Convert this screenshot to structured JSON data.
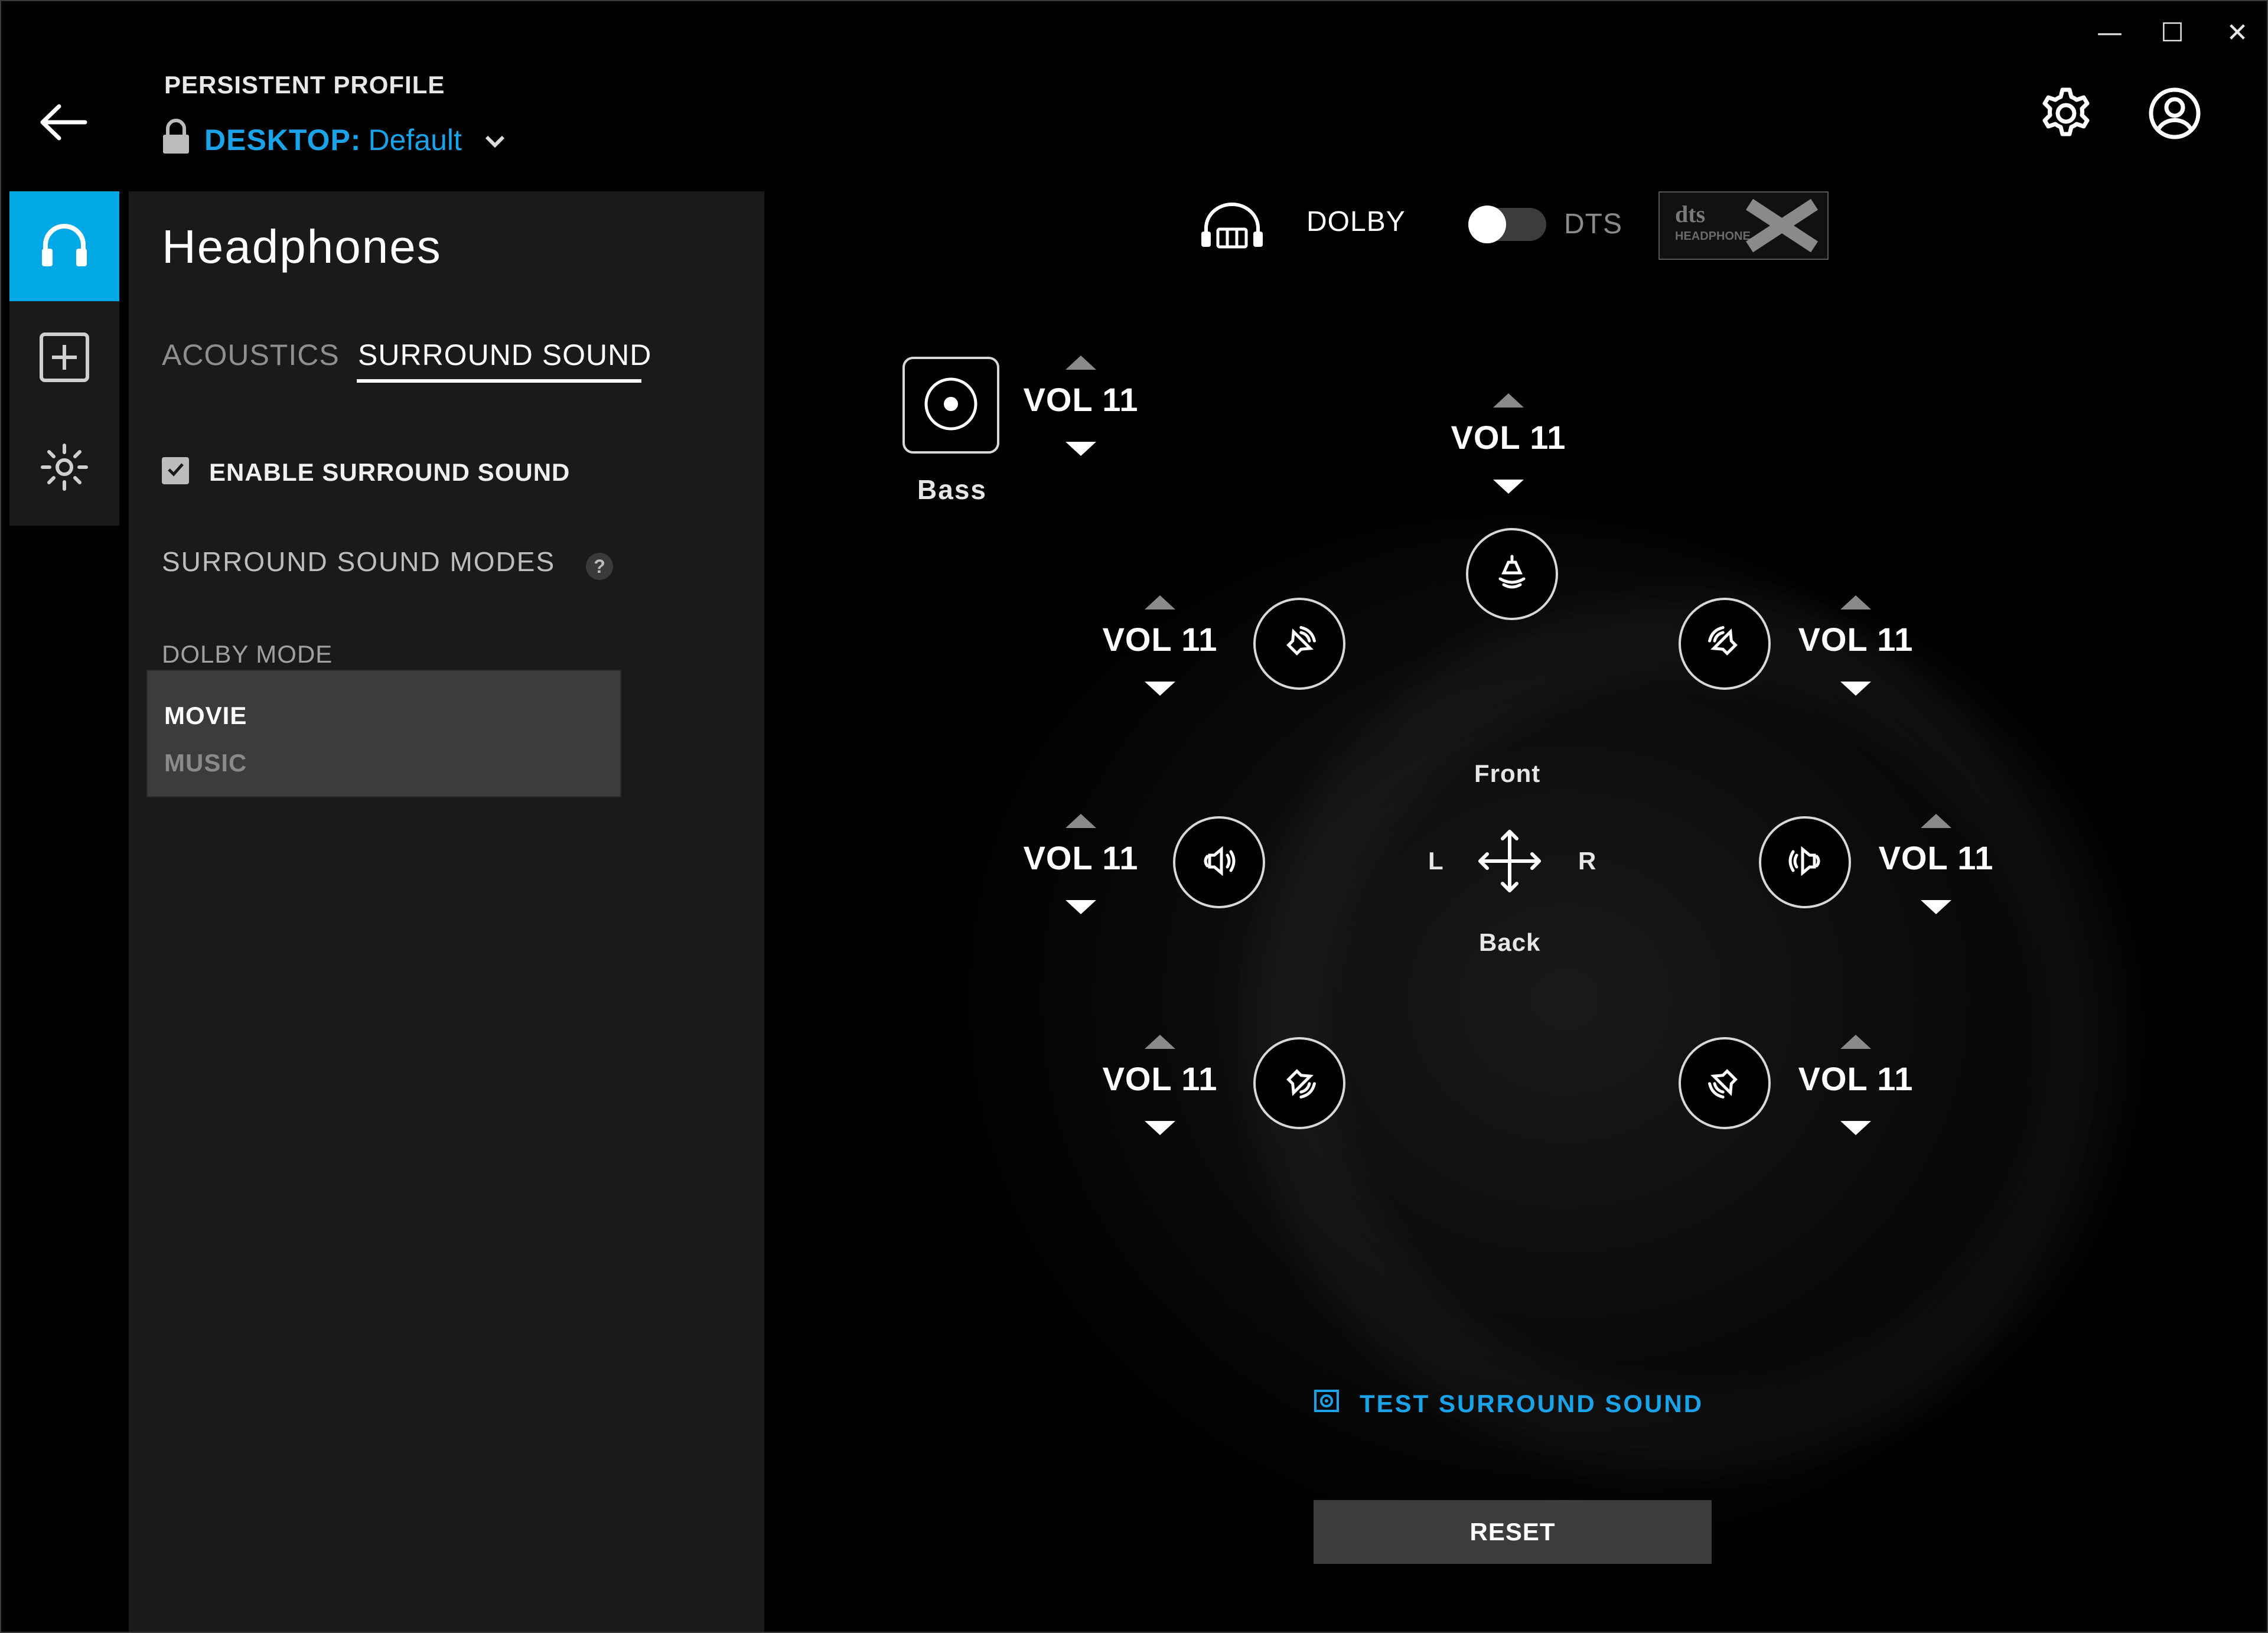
{
  "window": {
    "minimize": "—",
    "maximize": "☐",
    "close": "✕"
  },
  "header": {
    "profile_label": "PERSISTENT PROFILE",
    "profile_device": "DESKTOP:",
    "profile_name": "Default"
  },
  "panel": {
    "title": "Headphones",
    "tabs": [
      {
        "label": "ACOUSTICS",
        "active": false
      },
      {
        "label": "SURROUND SOUND",
        "active": true
      }
    ],
    "enable_surround": {
      "label": "ENABLE SURROUND SOUND",
      "checked": true
    },
    "modes_label": "SURROUND SOUND MODES",
    "help_glyph": "?",
    "dolby_mode_label": "DOLBY MODE",
    "dolby_mode_options": [
      "MOVIE",
      "MUSIC"
    ],
    "dolby_mode_selected": "MOVIE"
  },
  "codec": {
    "left_label": "DOLBY",
    "right_label": "DTS",
    "dts_logo_text": "dts HEADPHONE X"
  },
  "speakers": {
    "bass": {
      "label": "Bass",
      "vol": "VOL 11"
    },
    "center": {
      "vol": "VOL 11"
    },
    "front_left": {
      "vol": "VOL 11"
    },
    "front_right": {
      "vol": "VOL 11"
    },
    "side_left": {
      "vol": "VOL 11"
    },
    "side_right": {
      "vol": "VOL 11"
    },
    "rear_left": {
      "vol": "VOL 11"
    },
    "rear_right": {
      "vol": "VOL 11"
    }
  },
  "position": {
    "front": "Front",
    "back": "Back",
    "left": "L",
    "right": "R"
  },
  "actions": {
    "test_label": "TEST SURROUND SOUND",
    "reset_label": "RESET"
  },
  "colors": {
    "accent": "#00a8e6",
    "link": "#1aa3e8",
    "panel": "#1a1a1a",
    "button": "#3c3c3c"
  }
}
